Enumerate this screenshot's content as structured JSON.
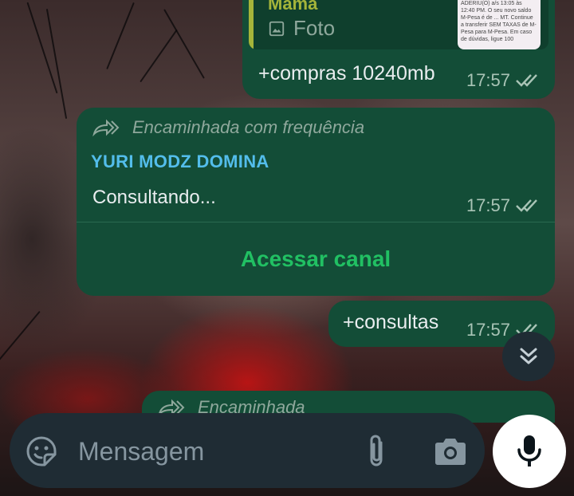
{
  "messages": [
    {
      "quoted": {
        "author": "Mama",
        "type_label": "Foto",
        "thumbnail_text": "ADERIU(O) a/s 13:05 às 12:40 PM. O seu novo saldo M-Pesa é de ... MT. Continue a transferir SEM TAXAS de M-Pesa para M-Pesa. Em caso de dúvidas, ligue 100"
      },
      "text": "+compras 10240mb",
      "time": "17:57",
      "status": "read"
    },
    {
      "forwarded_label": "Encaminhada com frequência",
      "sender": "YURI MODZ DOMINA",
      "text": "Consultando...",
      "time": "17:57",
      "status": "read",
      "action_label": "Acessar canal"
    },
    {
      "text": "+consultas",
      "time": "17:57",
      "status": "read"
    },
    {
      "forwarded_label": "Encaminhada"
    }
  ],
  "composer": {
    "placeholder": "Mensagem",
    "icons": [
      "sticker-icon",
      "paperclip-icon",
      "camera-icon",
      "microphone-icon"
    ]
  },
  "scroll_button": {
    "icon": "double-chevron-down-icon"
  },
  "colors": {
    "outgoing_bubble": "#134d37",
    "quote_bar": "#a5b43a",
    "sender_name": "#53bdeb",
    "action_text": "#21c063",
    "composer_bg": "#1f2c34",
    "mic_button": "#ffffff"
  }
}
